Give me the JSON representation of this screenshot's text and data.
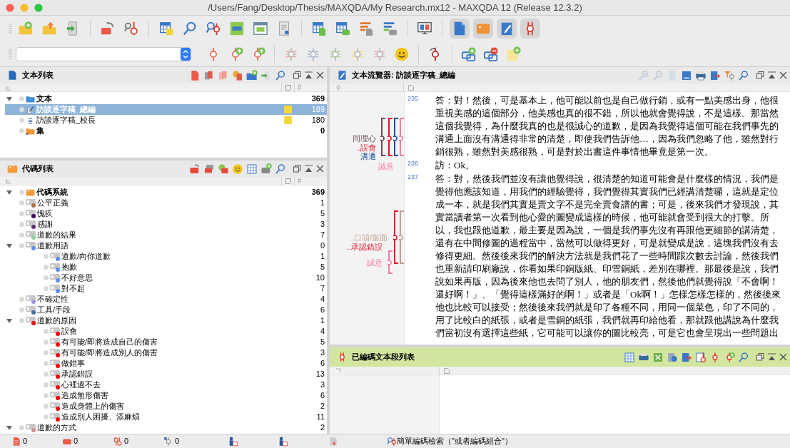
{
  "window": {
    "title": "/Users/Fang/Desktop/Thesis/MAXQDA/My Research.mx12 - MAXQDA 12 (Release 12.3.2)"
  },
  "main_toolbar": [
    {
      "pressed": false
    },
    {
      "pressed": false
    },
    {
      "pressed": false
    },
    {
      "pressed": false
    },
    {
      "pressed": false
    },
    {
      "pressed": false
    },
    {
      "pressed": false
    },
    {
      "pressed": false
    },
    {
      "pressed": false
    },
    {
      "pressed": false
    },
    {
      "pressed": false
    },
    {
      "pressed": false
    },
    {
      "pressed": false
    },
    {
      "pressed": false
    },
    {
      "pressed": false
    },
    {
      "pressed": false
    },
    {
      "pressed": true
    },
    {
      "pressed": true
    },
    {
      "pressed": true
    },
    {
      "pressed": true
    }
  ],
  "document_browser": {
    "title": "文本列表",
    "count_header": "#",
    "tree": [
      {
        "kind": "folder",
        "label": "文本",
        "count": "369",
        "selected": false,
        "expanded": true,
        "children": [
          {
            "kind": "document",
            "label": "訪談逐字稿_總編",
            "count": "189",
            "selected": true,
            "open": true,
            "memo": true
          },
          {
            "kind": "document",
            "label": "訪談逐字稿_校長",
            "count": "180",
            "selected": false,
            "open": false,
            "memo": true
          }
        ]
      },
      {
        "kind": "set",
        "label": "集",
        "count": "0",
        "selected": false
      }
    ]
  },
  "code_system": {
    "title": "代碼列表",
    "count_header": "#",
    "tree": [
      {
        "kind": "root",
        "label": "代碼系統",
        "count": "369",
        "expanded": true,
        "children": [
          {
            "kind": "code",
            "label": "公平正義",
            "count": "1",
            "color": "#b07040"
          },
          {
            "kind": "code",
            "label": "愧疚",
            "count": "5",
            "color": "#3a0a6a"
          },
          {
            "kind": "code",
            "label": "感謝",
            "count": "3",
            "color": "#6a2a7a"
          },
          {
            "kind": "code",
            "label": "道歉的結果",
            "count": "7",
            "color": "#90d090"
          },
          {
            "kind": "code",
            "label": "道歉用語",
            "count": "0",
            "color": "#5a90f0",
            "expanded": true,
            "children": [
              {
                "kind": "code",
                "label": "道歉/向你道歉",
                "count": "1",
                "color": "#5a90f0"
              },
              {
                "kind": "code",
                "label": "抱歉",
                "count": "5",
                "color": "#5a90f0"
              },
              {
                "kind": "code",
                "label": "不好意思",
                "count": "10",
                "color": "#5a90f0"
              },
              {
                "kind": "code",
                "label": "對不起",
                "count": "7",
                "color": "#5a90f0"
              }
            ]
          },
          {
            "kind": "code",
            "label": "不確定性",
            "count": "4",
            "color": "#a090e0"
          },
          {
            "kind": "code",
            "label": "工具/手段",
            "count": "6",
            "color": "#3a70b0"
          },
          {
            "kind": "code",
            "label": "道歉的原因",
            "count": "1",
            "color": "#ff0000",
            "expanded": true,
            "children": [
              {
                "kind": "code",
                "label": "誤會",
                "count": "4",
                "color": "#ff0000"
              },
              {
                "kind": "code",
                "label": "有可能/即將造成自己的傷害",
                "count": "5",
                "color": "#ff0000"
              },
              {
                "kind": "code",
                "label": "有可能/即將造成別人的傷害",
                "count": "3",
                "color": "#ff0000"
              },
              {
                "kind": "code",
                "label": "做錯事",
                "count": "6",
                "color": "#ff0000"
              },
              {
                "kind": "code",
                "label": "承認錯誤",
                "count": "13",
                "color": "#ff0000"
              },
              {
                "kind": "code",
                "label": "心裡過不去",
                "count": "3",
                "color": "#ff0000"
              },
              {
                "kind": "code",
                "label": "造成無形傷害",
                "count": "6",
                "color": "#ff0000"
              },
              {
                "kind": "code",
                "label": "造成身體上的傷害",
                "count": "2",
                "color": "#ff0000"
              },
              {
                "kind": "code",
                "label": "造成別人困擾、添麻煩",
                "count": "11",
                "color": "#ff0000"
              }
            ]
          },
          {
            "kind": "code",
            "label": "道歉的方式",
            "count": "2",
            "color": "#d09090",
            "expanded": true
          }
        ]
      }
    ]
  },
  "text_browser": {
    "title": "文本流覽器: 訪談逐字稿_總編",
    "paragraphs": [
      {
        "number": "235",
        "lines": [
          "答：對！然後，可是基本上，他可能以前也是自己做行銷，或有一點美感出身，他很",
          "重視美感的這個部分，他美感也真的很不錯，所以他就會覺得說，不是這樣。那當然",
          "這個我覺得，為什麼我真的也是很誠心的道歉，是因為我覺得這個可能在我們事先的",
          "溝通上面沒有溝通得非常的清楚，即使我們告訴他…，因為我們忽略了他，雖然對行",
          "銷很熟，雖然對美感很熟，可是對於出書這件事情他畢竟是第一次。"
        ],
        "codes": [
          {
            "label": "同理心",
            "color": "#6b4a5e"
          },
          {
            "label": "..誤會",
            "color": "#e8142c"
          },
          {
            "label": "溝通",
            "color": "#1c4f9c"
          },
          {
            "label": "誠意",
            "color": "#f07aa8"
          }
        ]
      },
      {
        "number": "236",
        "lines": [
          "訪：Ok。"
        ]
      },
      {
        "number": "237",
        "lines": [
          "答：對，然後我們並沒有讓他覺得說，很清楚的知道可能會是什麼樣的情況，我們是",
          "覺得他應該知道，用我們的經驗覺得，我們覺得其實我們已經講清楚囉，這就是定位",
          "成一本，就是我們其實是賣文字不是完全賣食譜的書；可是，後來我們才發現說，其",
          "實當讀者第一次看到他心愛的圖變成這樣的時候，他可能就會受到很大的打擊。所",
          "以，我也跟他道歉，最主要是因為說，一個是我們事先沒有再跟他更細節的講清楚，",
          "還有在中間修圖的過程當中，當然可以做得更好，可是就變成是說，這塊我們沒有去",
          "修得更細。然後後來我們的解決方法就是我們花了一些時間跟次數去討論，然後我們",
          "也重新請印刷廠說，你看如果印銅版紙、印雪銅紙，差別在哪裡。那最後是說，我們",
          "說如果再版，因為後來他也去問了別人，他的朋友們，然後他們就覺得說「不會啊！",
          "還好啊！」、「覺得這樣滿好的啊！」或者是「Ok啊！」怎樣怎樣怎樣的，然後後來",
          "他也比較可以接受；然後後來我們就是印了各種不同，用同一個菜色，印了不同的，",
          "用了比較白的紙張，或者是雪銅的紙張，我們就再印給他看，那就跟他講說為什麼我",
          "們當初沒有選擇這些紙，它可能可以讓你的圖比較亮，可是它也會呈現出一些問題出"
        ],
        "codes": [
          {
            "label": "..口頭/當面",
            "color": "#c0a090"
          },
          {
            "label": "..承認錯誤",
            "color": "#e8142c"
          },
          {
            "label": "誠意",
            "color": "#f07aa8"
          }
        ]
      }
    ]
  },
  "retrieved_segments": {
    "title": "已編碼文本段列表"
  },
  "status_bar": {
    "counts": [
      "0",
      "0",
      "0",
      "0"
    ],
    "retrieval_mode": "簡單編碼檢索（\"或者編碼組合\"）"
  }
}
